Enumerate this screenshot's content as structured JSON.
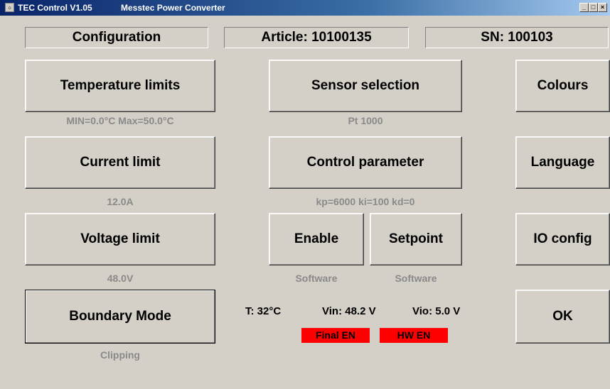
{
  "window": {
    "title": "TEC Control V1.05",
    "subtitle": "Messtec Power Converter",
    "icon": "app-icon",
    "minimize_glyph": "_",
    "maximize_glyph": "□",
    "close_glyph": "×"
  },
  "header": {
    "configuration": "Configuration",
    "article": "Article: 10100135",
    "serial": "SN: 100103"
  },
  "buttons": {
    "temperature_limits": {
      "label": "Temperature limits",
      "sub": "MIN=0.0°C   Max=50.0°C"
    },
    "current_limit": {
      "label": "Current limit",
      "sub": "12.0A"
    },
    "voltage_limit": {
      "label": "Voltage limit",
      "sub": "48.0V"
    },
    "boundary_mode": {
      "label": "Boundary Mode",
      "sub": "Clipping"
    },
    "sensor_selection": {
      "label": "Sensor selection",
      "sub": "Pt 1000"
    },
    "control_parameter": {
      "label": "Control parameter",
      "sub": "kp=6000 ki=100 kd=0"
    },
    "enable": {
      "label": "Enable",
      "sub": "Software"
    },
    "setpoint": {
      "label": "Setpoint",
      "sub": "Software"
    },
    "colours": {
      "label": "Colours"
    },
    "language": {
      "label": "Language"
    },
    "io_config": {
      "label": "IO config"
    },
    "ok": {
      "label": "OK"
    }
  },
  "status": {
    "temperature": "T:  32°C",
    "vin": "Vin:  48.2 V",
    "vio": "Vio: 5.0 V",
    "final_en": "Final EN",
    "hw_en": "HW EN",
    "badge_color": "#ff0000"
  }
}
